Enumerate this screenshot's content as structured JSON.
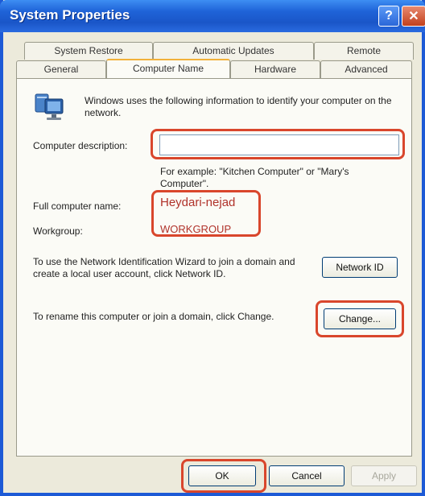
{
  "window": {
    "title": "System Properties",
    "help_glyph": "?",
    "close_glyph": "✕"
  },
  "tabs": {
    "row_back": [
      "System Restore",
      "Automatic Updates",
      "Remote"
    ],
    "row_front": [
      "General",
      "Computer Name",
      "Hardware",
      "Advanced"
    ],
    "active": "Computer Name"
  },
  "panel": {
    "intro_text": "Windows uses the following information to identify your computer on the network.",
    "description_label": "Computer description:",
    "description_value": "",
    "example_text": "For example: \"Kitchen Computer\" or \"Mary's Computer\".",
    "full_name_label": "Full computer name:",
    "full_name_value": "Heydari-nejad",
    "workgroup_label": "Workgroup:",
    "workgroup_value": "WORKGROUP",
    "wizard_text": "To use the Network Identification Wizard to join a domain and create a local user account, click Network ID.",
    "network_id_button": "Network ID",
    "rename_text": "To rename this computer or join a domain, click Change.",
    "change_button": "Change..."
  },
  "footer": {
    "ok_button": "OK",
    "cancel_button": "Cancel",
    "apply_button": "Apply"
  },
  "colors": {
    "titlebar": "#1f63d8",
    "highlight": "#d9462c",
    "tab_accent": "#f2b13a",
    "value_text": "#b0322a"
  }
}
